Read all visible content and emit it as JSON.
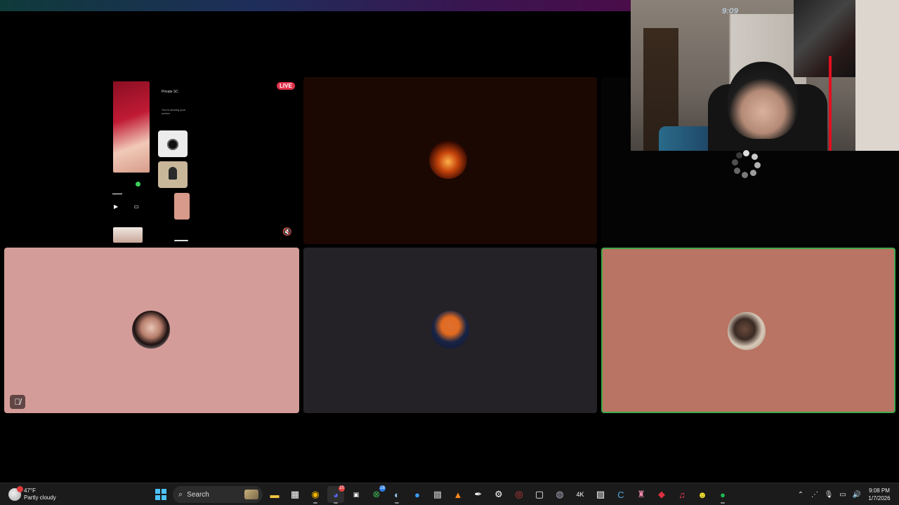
{
  "share": {
    "live_label": "LIVE",
    "phone_header": "Private SC",
    "phone_sub": "You're sharing your screen",
    "mute_icon": "speaker-muted-icon"
  },
  "webcam": {
    "clock_overlay": "9:09"
  },
  "tiles": [
    {
      "name": "participant-fire-avatar",
      "color": "#1c0802"
    },
    {
      "name": "participant-woman-avatar",
      "color": "#d49c98",
      "muted": true
    },
    {
      "name": "participant-juice-avatar",
      "color": "#242226"
    },
    {
      "name": "participant-cat-avatar",
      "color": "#b97463",
      "speaking": true
    }
  ],
  "taskbar": {
    "weather_temp": "47°F",
    "weather_desc": "Partly cloudy",
    "search_label": "Search",
    "discord_badge": "10",
    "xbox_badge": "18",
    "clock_time": "9:08 PM",
    "clock_date": "1/7/2026",
    "accent": "#4cc2ff"
  }
}
